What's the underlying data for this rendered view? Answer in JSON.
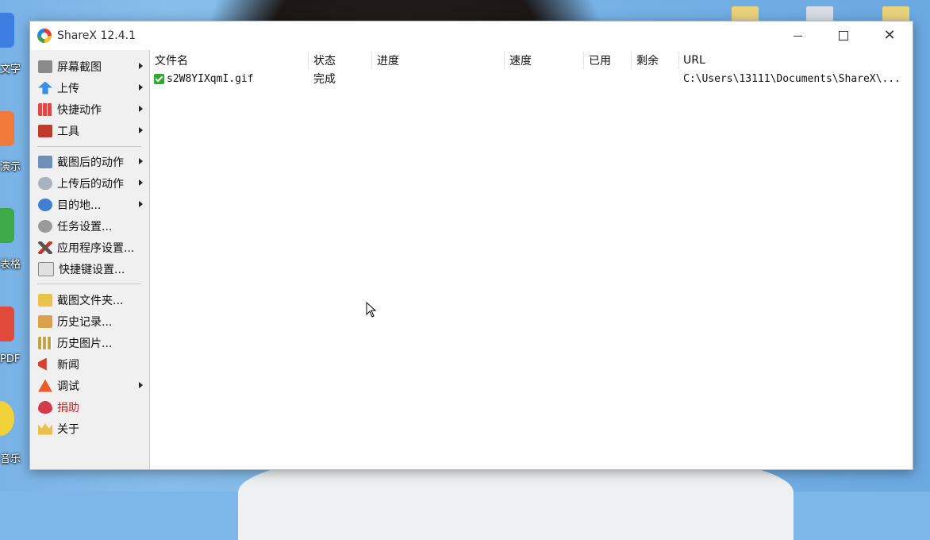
{
  "window": {
    "title": "ShareX 12.4.1"
  },
  "sidebar": {
    "items": [
      {
        "label": "屏幕截图",
        "icon": "screen-capture-icon",
        "submenu": true
      },
      {
        "label": "上传",
        "icon": "upload-arrow-icon",
        "submenu": true
      },
      {
        "label": "快捷动作",
        "icon": "workflows-grid-icon",
        "submenu": true
      },
      {
        "label": "工具",
        "icon": "toolbox-icon",
        "submenu": true
      },
      {
        "label": "截图后的动作",
        "icon": "after-capture-icon",
        "submenu": true
      },
      {
        "label": "上传后的动作",
        "icon": "after-upload-cloud-icon",
        "submenu": true
      },
      {
        "label": "目的地...",
        "icon": "destinations-globe-icon",
        "submenu": true
      },
      {
        "label": "任务设置...",
        "icon": "task-settings-gear-icon",
        "submenu": false
      },
      {
        "label": "应用程序设置...",
        "icon": "app-settings-wrench-icon",
        "submenu": false
      },
      {
        "label": "快捷键设置...",
        "icon": "hotkey-settings-icon",
        "submenu": false
      },
      {
        "label": "截图文件夹...",
        "icon": "screenshots-folder-icon",
        "submenu": false
      },
      {
        "label": "历史记录...",
        "icon": "history-icon",
        "submenu": false
      },
      {
        "label": "历史图片...",
        "icon": "image-history-icon",
        "submenu": false
      },
      {
        "label": "新闻",
        "icon": "news-megaphone-icon",
        "submenu": false
      },
      {
        "label": "调试",
        "icon": "debug-cone-icon",
        "submenu": true
      },
      {
        "label": "捐助",
        "icon": "donate-heart-icon",
        "submenu": false
      },
      {
        "label": "关于",
        "icon": "about-crown-icon",
        "submenu": false
      }
    ]
  },
  "list": {
    "columns": [
      "文件名",
      "状态",
      "进度",
      "速度",
      "已用",
      "剩余",
      "URL"
    ],
    "rows": [
      {
        "filename": "s2W8YIXqmI.gif",
        "status": "完成",
        "progress": "",
        "speed": "",
        "elapsed": "",
        "remaining": "",
        "url": "C:\\Users\\13111\\Documents\\ShareX\\..."
      }
    ]
  },
  "desktop": {
    "left_labels": [
      "文字",
      "演示",
      "表格",
      "PDF",
      "音乐"
    ]
  },
  "colors": {
    "accent_red": "#d12020",
    "check_green": "#2faa2f",
    "desktop_blue": "#79b3e6"
  }
}
